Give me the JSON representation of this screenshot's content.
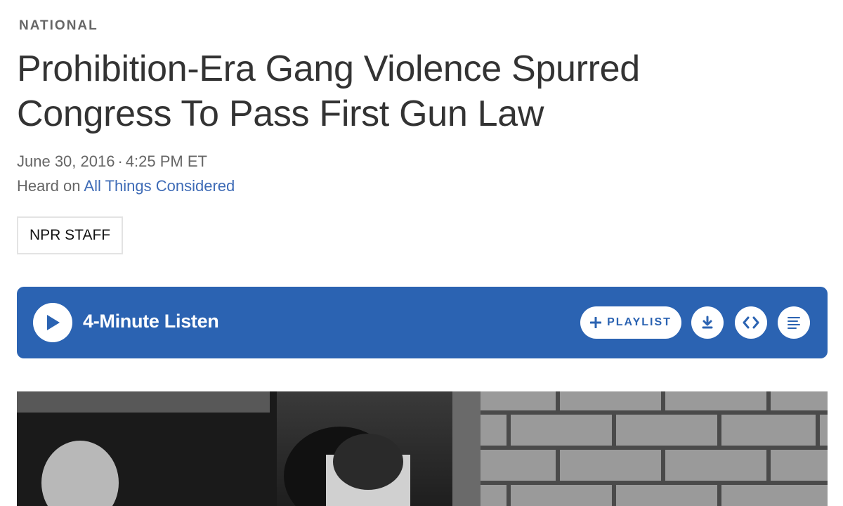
{
  "section": "NATIONAL",
  "headline": "Prohibition-Era Gang Violence Spurred Congress To Pass First Gun Law",
  "dateline": {
    "date": "June 30, 2016",
    "separator": "·",
    "time": "4:25 PM ET"
  },
  "heard_on": {
    "prefix": "Heard on",
    "program": "All Things Considered"
  },
  "byline": "NPR STAFF",
  "player": {
    "listen_label": "4-Minute Listen",
    "playlist_label": "PLAYLIST",
    "play_icon": "play-icon",
    "playlist_icon": "plus-icon",
    "download_icon": "download-icon",
    "embed_icon": "embed-code-icon",
    "transcript_icon": "transcript-icon"
  },
  "colors": {
    "player_bg": "#2b63b2",
    "link": "#3e6bb6",
    "text": "#333333",
    "muted": "#666666"
  },
  "photo": {
    "description_type": "black-and-white archival photo",
    "icon": "photo"
  }
}
